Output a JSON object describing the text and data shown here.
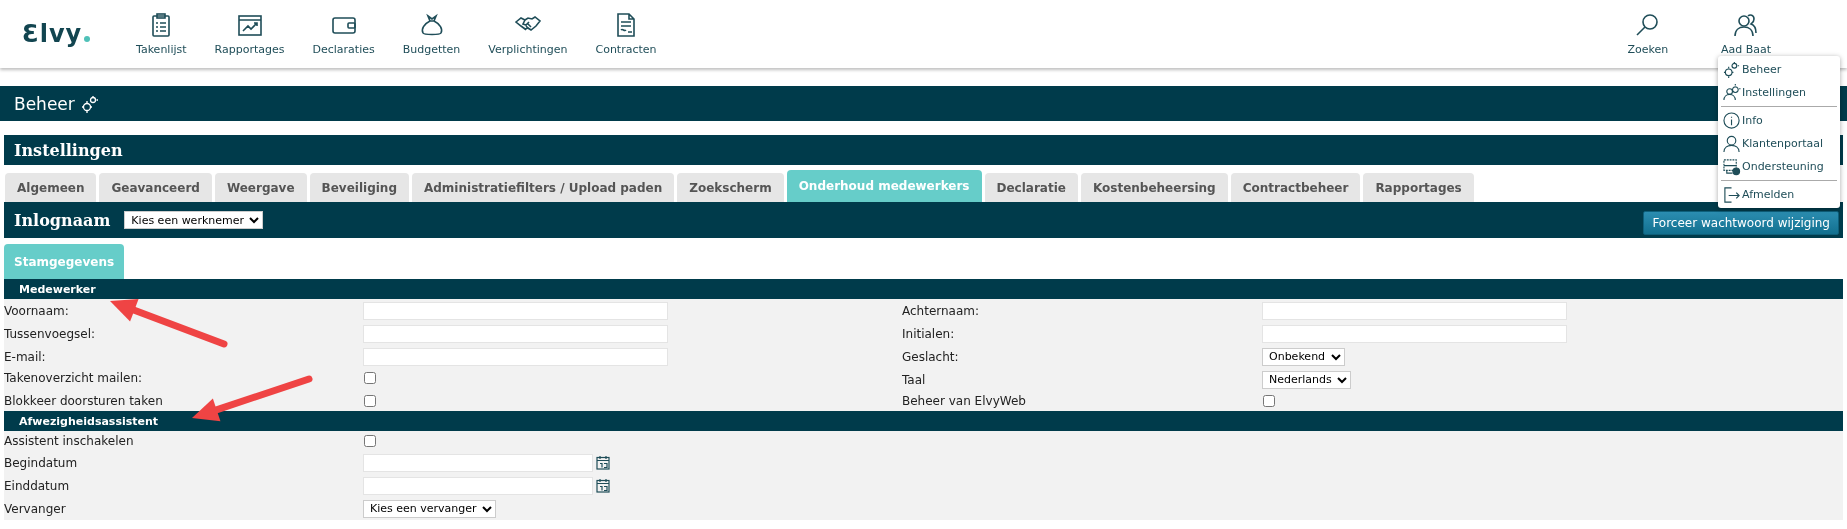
{
  "header": {
    "logo": "Ɛlvy",
    "nav": [
      {
        "label": "Takenlijst"
      },
      {
        "label": "Rapportages"
      },
      {
        "label": "Declaraties"
      },
      {
        "label": "Budgetten"
      },
      {
        "label": "Verplichtingen"
      },
      {
        "label": "Contracten"
      }
    ],
    "right": [
      {
        "label": "Zoeken"
      },
      {
        "label": "Aad Baat"
      }
    ]
  },
  "user_menu": {
    "groups": [
      [
        {
          "label": "Beheer"
        },
        {
          "label": "Instellingen"
        }
      ],
      [
        {
          "label": "Info"
        },
        {
          "label": "Klantenportaal"
        },
        {
          "label": "Ondersteuning"
        }
      ],
      [
        {
          "label": "Afmelden"
        }
      ]
    ]
  },
  "page_title": "Beheer",
  "panel": {
    "title": "Instellingen",
    "tabs": [
      {
        "label": "Algemeen",
        "selected": false
      },
      {
        "label": "Geavanceerd",
        "selected": false
      },
      {
        "label": "Weergave",
        "selected": false
      },
      {
        "label": "Beveiliging",
        "selected": false
      },
      {
        "label": "Administratiefilters / Upload paden",
        "selected": false
      },
      {
        "label": "Zoekscherm",
        "selected": false
      },
      {
        "label": "Onderhoud medewerkers",
        "selected": true
      },
      {
        "label": "Declaratie",
        "selected": false
      },
      {
        "label": "Kostenbeheersing",
        "selected": false
      },
      {
        "label": "Contractbeheer",
        "selected": false
      },
      {
        "label": "Rapportages",
        "selected": false
      }
    ],
    "login": {
      "label": "Inlognaam",
      "select": "Kies een werknemer"
    },
    "force_button": "Forceer wachtwoord wijziging",
    "subtabs": [
      {
        "label": "Stamgegevens",
        "selected": true
      }
    ],
    "sections": [
      {
        "title": "Medewerker",
        "left": [
          {
            "label": "Voornaam:",
            "kind": "text"
          },
          {
            "label": "Tussenvoegsel:",
            "kind": "text"
          },
          {
            "label": "E-mail:",
            "kind": "text"
          },
          {
            "label": "Takenoverzicht mailen:",
            "kind": "checkbox",
            "checked": false
          },
          {
            "label": "Blokkeer doorsturen taken",
            "kind": "checkbox",
            "checked": false
          }
        ],
        "right": [
          {
            "label": "Achternaam:",
            "kind": "text"
          },
          {
            "label": "Initialen:",
            "kind": "text"
          },
          {
            "label": "Geslacht:",
            "kind": "select",
            "value": "Onbekend"
          },
          {
            "label": "Taal",
            "kind": "select",
            "value": "Nederlands"
          },
          {
            "label": "Beheer van ElvyWeb",
            "kind": "checkbox",
            "checked": false
          }
        ]
      },
      {
        "title": "Afwezigheidsassistent",
        "left": [
          {
            "label": "Assistent inschakelen",
            "kind": "checkbox",
            "checked": false
          },
          {
            "label": "Begindatum",
            "kind": "date"
          },
          {
            "label": "Einddatum",
            "kind": "date"
          },
          {
            "label": "Vervanger",
            "kind": "select",
            "value": "Kies een vervanger"
          }
        ]
      }
    ]
  },
  "annotations": [
    {
      "kind": "arrow"
    },
    {
      "kind": "arrow"
    }
  ]
}
